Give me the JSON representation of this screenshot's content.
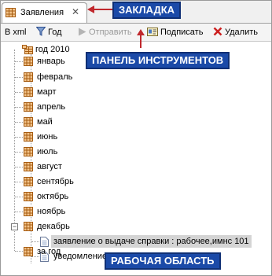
{
  "tab": {
    "label": "Заявления",
    "close_glyph": "✕"
  },
  "callouts": {
    "tab": "ЗАКЛАДКА",
    "toolbar": "ПАНЕЛЬ ИНСТРУМЕНТОВ",
    "workspace": "РАБОЧАЯ ОБЛАСТЬ"
  },
  "toolbar": {
    "xml": "В xml",
    "year": "Год",
    "send": "Отправить",
    "sign": "Подписать",
    "delete": "Удалить"
  },
  "tree": {
    "root": "год 2010",
    "months": [
      "январь",
      "февраль",
      "март",
      "апрель",
      "май",
      "июнь",
      "июль",
      "август",
      "сентябрь",
      "октябрь",
      "ноябрь",
      "декабрь"
    ],
    "december_docs": [
      "заявление о выдаче справки : рабочее,имнс 101",
      "уведомление : рабочее,имнс 101"
    ],
    "next": "за год"
  },
  "colors": {
    "callout_bg": "#1b4aa8",
    "arrow": "#c0282d",
    "selection": "#d4d4d4"
  }
}
